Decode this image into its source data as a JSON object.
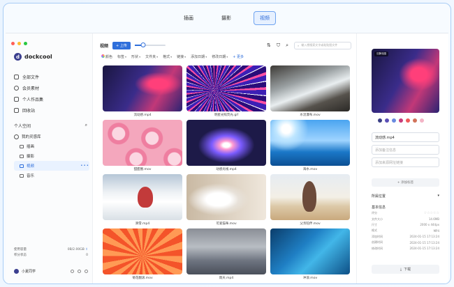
{
  "top_tabs": [
    {
      "label": "插画"
    },
    {
      "label": "摄影"
    },
    {
      "label": "视频"
    }
  ],
  "sidebar": {
    "brand": "dockcool",
    "nav": [
      {
        "label": "全部文件",
        "icon": "layers-icon"
      },
      {
        "label": "会员素材",
        "icon": "bulb-icon"
      },
      {
        "label": "个人作品集",
        "icon": "portfolio-icon"
      },
      {
        "label": "回收站",
        "icon": "trash-icon"
      }
    ],
    "space_title": "个人空间",
    "library": "我的灵感库",
    "folders": [
      {
        "label": "插画"
      },
      {
        "label": "摄影"
      },
      {
        "label": "视频"
      },
      {
        "label": "音乐"
      }
    ],
    "active_more": "•••",
    "storage": {
      "used_label": "使用容量",
      "used_value": "0B/2.00GB",
      "status_label": "积分状态",
      "status_value": "0"
    },
    "username": "小夏同学"
  },
  "toolbar": {
    "title": "视频",
    "upload": "+ 上传",
    "search_placeholder": "输入想搜索文字或粘贴图文件",
    "zoom": 0.28
  },
  "filters": [
    {
      "label": "颜色"
    },
    {
      "label": "标签"
    },
    {
      "label": "形状"
    },
    {
      "label": "文件夹"
    },
    {
      "label": "格式"
    },
    {
      "label": "链接"
    },
    {
      "label": "添加日期"
    },
    {
      "label": "修改日期"
    }
  ],
  "filter_more": "+ 更多",
  "assets": [
    {
      "name": "流动感.mp4"
    },
    {
      "name": "明星光照荧光.gif"
    },
    {
      "name": "水流瀑布.mov"
    },
    {
      "name": "甜甜圈.mov"
    },
    {
      "name": "动感光线.mp4"
    },
    {
      "name": "海水.mov"
    },
    {
      "name": "滑雪.mp4"
    },
    {
      "name": "可爱猫咪.mov"
    },
    {
      "name": "父亲陪伴.mov"
    },
    {
      "name": "菊花翻滚.mov"
    },
    {
      "name": "雨天.mp4"
    },
    {
      "name": "冲浪.mov"
    }
  ],
  "detail": {
    "preview_badge": "沉静流感",
    "swatches": [
      "#3a3f86",
      "#5b4fb6",
      "#6a8be0",
      "#c83c7a",
      "#f05a5a",
      "#d2735a",
      "#f3b4c6"
    ],
    "filename": "流动感.mp4",
    "note_placeholder": "添加备注信息",
    "source_placeholder": "添加来源网址链接",
    "add_tag": "+ 添加标签",
    "folder_section": "所属位置",
    "basic_section": "基本信息",
    "meta": [
      {
        "label": "评分",
        "value": ""
      },
      {
        "label": "文件大小",
        "value": "14.6MB"
      },
      {
        "label": "尺寸",
        "value": "2000 x 444px"
      },
      {
        "label": "格式",
        "value": "MP4"
      },
      {
        "label": "添加时间",
        "value": "2024-01-15 17:13:24"
      },
      {
        "label": "创建时间",
        "value": "2024-01-15 17:13:24"
      },
      {
        "label": "修改时间",
        "value": "2024-01-15 17:13:24"
      }
    ],
    "download": "下载"
  }
}
